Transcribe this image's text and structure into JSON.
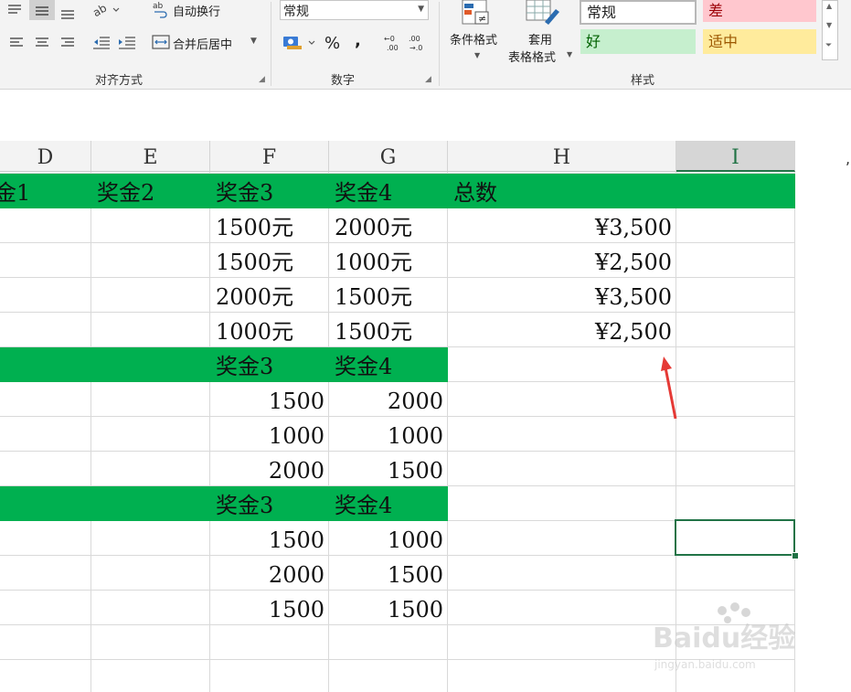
{
  "ribbon": {
    "alignment": {
      "wrap_text": "自动换行",
      "merge_center": "合并后居中",
      "group_label": "对齐方式"
    },
    "number": {
      "format_value": "常规",
      "percent": "%",
      "comma": ",",
      "group_label": "数字"
    },
    "cond_format": "条件格式",
    "table_format_line1": "套用",
    "table_format_line2": "表格格式",
    "styles": {
      "normal": "常规",
      "bad": "差",
      "good": "好",
      "neutral": "适中",
      "group_label": "样式"
    },
    "colors": {
      "bad_bg": "#ffc7ce",
      "bad_fg": "#9c0006",
      "good_bg": "#c6efce",
      "good_fg": "#006100",
      "neutral_bg": "#ffeb9c",
      "neutral_fg": "#9c5700"
    }
  },
  "columns": [
    "D",
    "E",
    "F",
    "G",
    "H",
    "I"
  ],
  "header_row_1": {
    "d": "金1",
    "e": "奖金2",
    "f": "奖金3",
    "g": "奖金4",
    "h": "总数"
  },
  "rows_1": [
    {
      "f": "1500元",
      "g": "2000元",
      "h": "¥3,500"
    },
    {
      "f": "1500元",
      "g": "1000元",
      "h": "¥2,500"
    },
    {
      "f": "2000元",
      "g": "1500元",
      "h": "¥3,500"
    },
    {
      "f": "1000元",
      "g": "1500元",
      "h": "¥2,500"
    }
  ],
  "header_row_2": {
    "f": "奖金3",
    "g": "奖金4"
  },
  "rows_2": [
    {
      "f": "1500",
      "g": "2000"
    },
    {
      "f": "1000",
      "g": "1000"
    },
    {
      "f": "2000",
      "g": "1500"
    }
  ],
  "header_row_3": {
    "f": "奖金3",
    "g": "奖金4"
  },
  "rows_3": [
    {
      "f": "1500",
      "g": "1000"
    },
    {
      "f": "2000",
      "g": "1500"
    },
    {
      "f": "1500",
      "g": "1500"
    }
  ],
  "header_fill_color": "#00b050",
  "selection_color": "#217346",
  "annotation_arrow_color": "#e53935",
  "watermark": {
    "logo": "Baidu经验",
    "url": "jingyan.baidu.com"
  }
}
